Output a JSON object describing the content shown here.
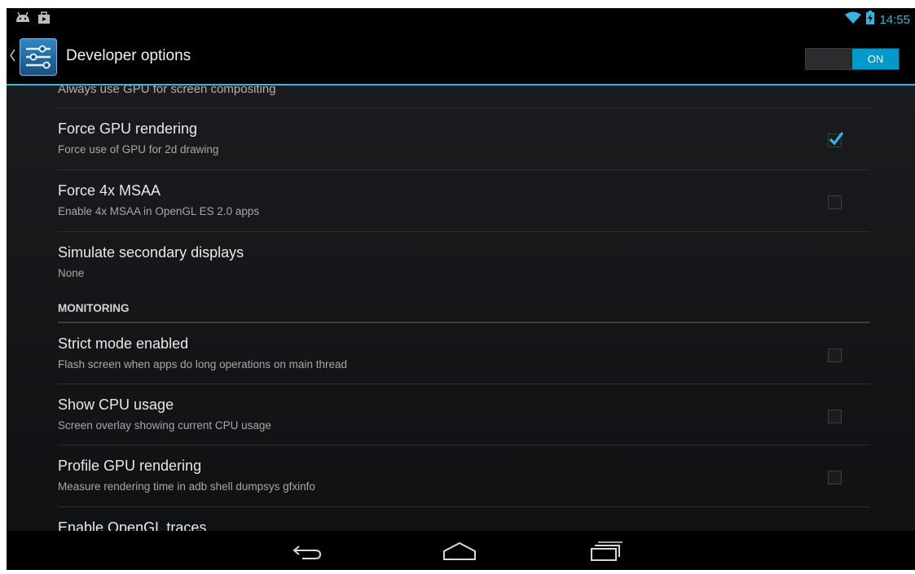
{
  "status_bar": {
    "time": "14:55"
  },
  "action_bar": {
    "title": "Developer options",
    "switch_label": "ON"
  },
  "cut_item": {
    "summary": "Always use GPU for screen compositing"
  },
  "items_top": [
    {
      "title": "Force GPU rendering",
      "summary": "Force use of GPU for 2d drawing",
      "checked": true
    },
    {
      "title": "Force 4x MSAA",
      "summary": "Enable 4x MSAA in OpenGL ES 2.0 apps",
      "checked": false
    },
    {
      "title": "Simulate secondary displays",
      "summary": "None"
    }
  ],
  "section": {
    "title": "MONITORING"
  },
  "items_monitoring": [
    {
      "title": "Strict mode enabled",
      "summary": "Flash screen when apps do long operations on main thread",
      "checked": false
    },
    {
      "title": "Show CPU usage",
      "summary": "Screen overlay showing current CPU usage",
      "checked": false
    },
    {
      "title": "Profile GPU rendering",
      "summary": "Measure rendering time in adb shell dumpsys gfxinfo",
      "checked": false
    },
    {
      "title": "Enable OpenGL traces"
    }
  ],
  "colors": {
    "accent": "#33b5e5",
    "switch_on": "#0099cc",
    "background": "#17191b"
  },
  "icons": {
    "status_left": [
      "android-icon",
      "notification-icon"
    ],
    "status_right": [
      "wifi-icon",
      "battery-charging-icon"
    ],
    "nav": [
      "back-icon",
      "home-icon",
      "recent-apps-icon"
    ]
  }
}
